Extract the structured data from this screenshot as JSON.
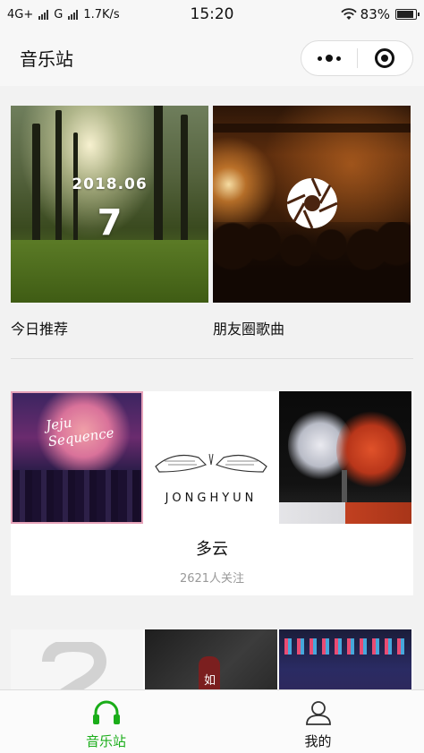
{
  "status_bar": {
    "network_1": "4G+",
    "network_2": "G",
    "speed": "1.7K/s",
    "time": "15:20",
    "battery": "83%",
    "battery_level": 0.83
  },
  "nav": {
    "title": "音乐站"
  },
  "top_cards": [
    {
      "label": "今日推荐",
      "date": "2018.06",
      "day": "7"
    },
    {
      "label": "朋友圈歌曲"
    }
  ],
  "playlists": [
    {
      "title": "多云",
      "subtitle": "2621人关注",
      "cover_texts": [
        "Jeju Sequence",
        "JONGHYUN"
      ]
    },
    {
      "cover_texts": [
        "如"
      ]
    }
  ],
  "tabbar": {
    "items": [
      {
        "label": "音乐站",
        "active": true
      },
      {
        "label": "我的",
        "active": false
      }
    ]
  },
  "colors": {
    "accent": "#1aad19",
    "background": "#f2f2f2"
  }
}
